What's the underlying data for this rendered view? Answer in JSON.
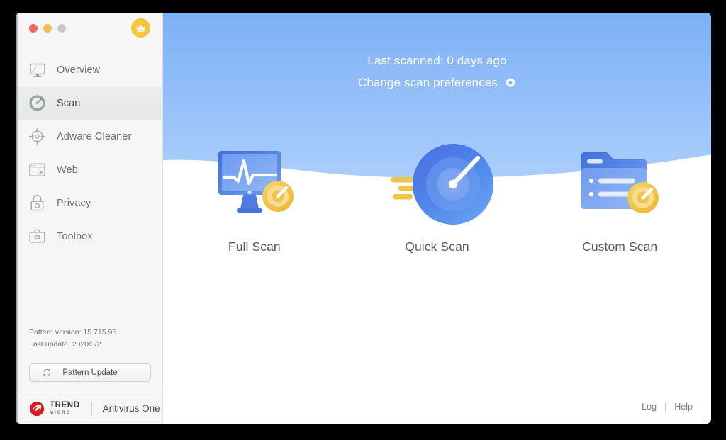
{
  "window": {
    "traffic_lights": [
      {
        "name": "close",
        "color": "#ee6a5f"
      },
      {
        "name": "minimize",
        "color": "#f4bd4f"
      },
      {
        "name": "zoom",
        "color": "#c9c9c9"
      }
    ],
    "premium_badge_icon": "crown-icon",
    "premium_badge_color": "#f5c53e"
  },
  "sidebar": {
    "items": [
      {
        "label": "Overview",
        "icon": "monitor-icon",
        "active": false
      },
      {
        "label": "Scan",
        "icon": "gauge-icon",
        "active": true
      },
      {
        "label": "Adware Cleaner",
        "icon": "target-icon",
        "active": false
      },
      {
        "label": "Web",
        "icon": "browser-icon",
        "active": false
      },
      {
        "label": "Privacy",
        "icon": "lock-icon",
        "active": false
      },
      {
        "label": "Toolbox",
        "icon": "toolbox-icon",
        "active": false
      }
    ],
    "pattern_version": "Pattern version: 15.715.95",
    "last_update": "Last update: 2020/3/2",
    "pattern_update_button": "Pattern Update",
    "pattern_update_icon": "refresh-icon",
    "brand": {
      "logo_icon": "trend-micro-logo-icon",
      "name_top": "TREND",
      "name_bottom": "MICRO",
      "product": "Antivirus One"
    }
  },
  "main": {
    "last_scanned": "Last scanned: 0 days ago",
    "change_preferences": "Change scan preferences",
    "preferences_icon": "gear-icon",
    "hero_color_top": "#7eb2f7",
    "hero_color_bottom": "#a9cdfb",
    "scan_options": [
      {
        "label": "Full Scan",
        "icon": "monitor-pulse-gauge-icon"
      },
      {
        "label": "Quick Scan",
        "icon": "radar-gauge-icon"
      },
      {
        "label": "Custom Scan",
        "icon": "folder-checklist-gauge-icon"
      }
    ],
    "footer": {
      "log": "Log",
      "separator": "|",
      "help": "Help"
    }
  }
}
